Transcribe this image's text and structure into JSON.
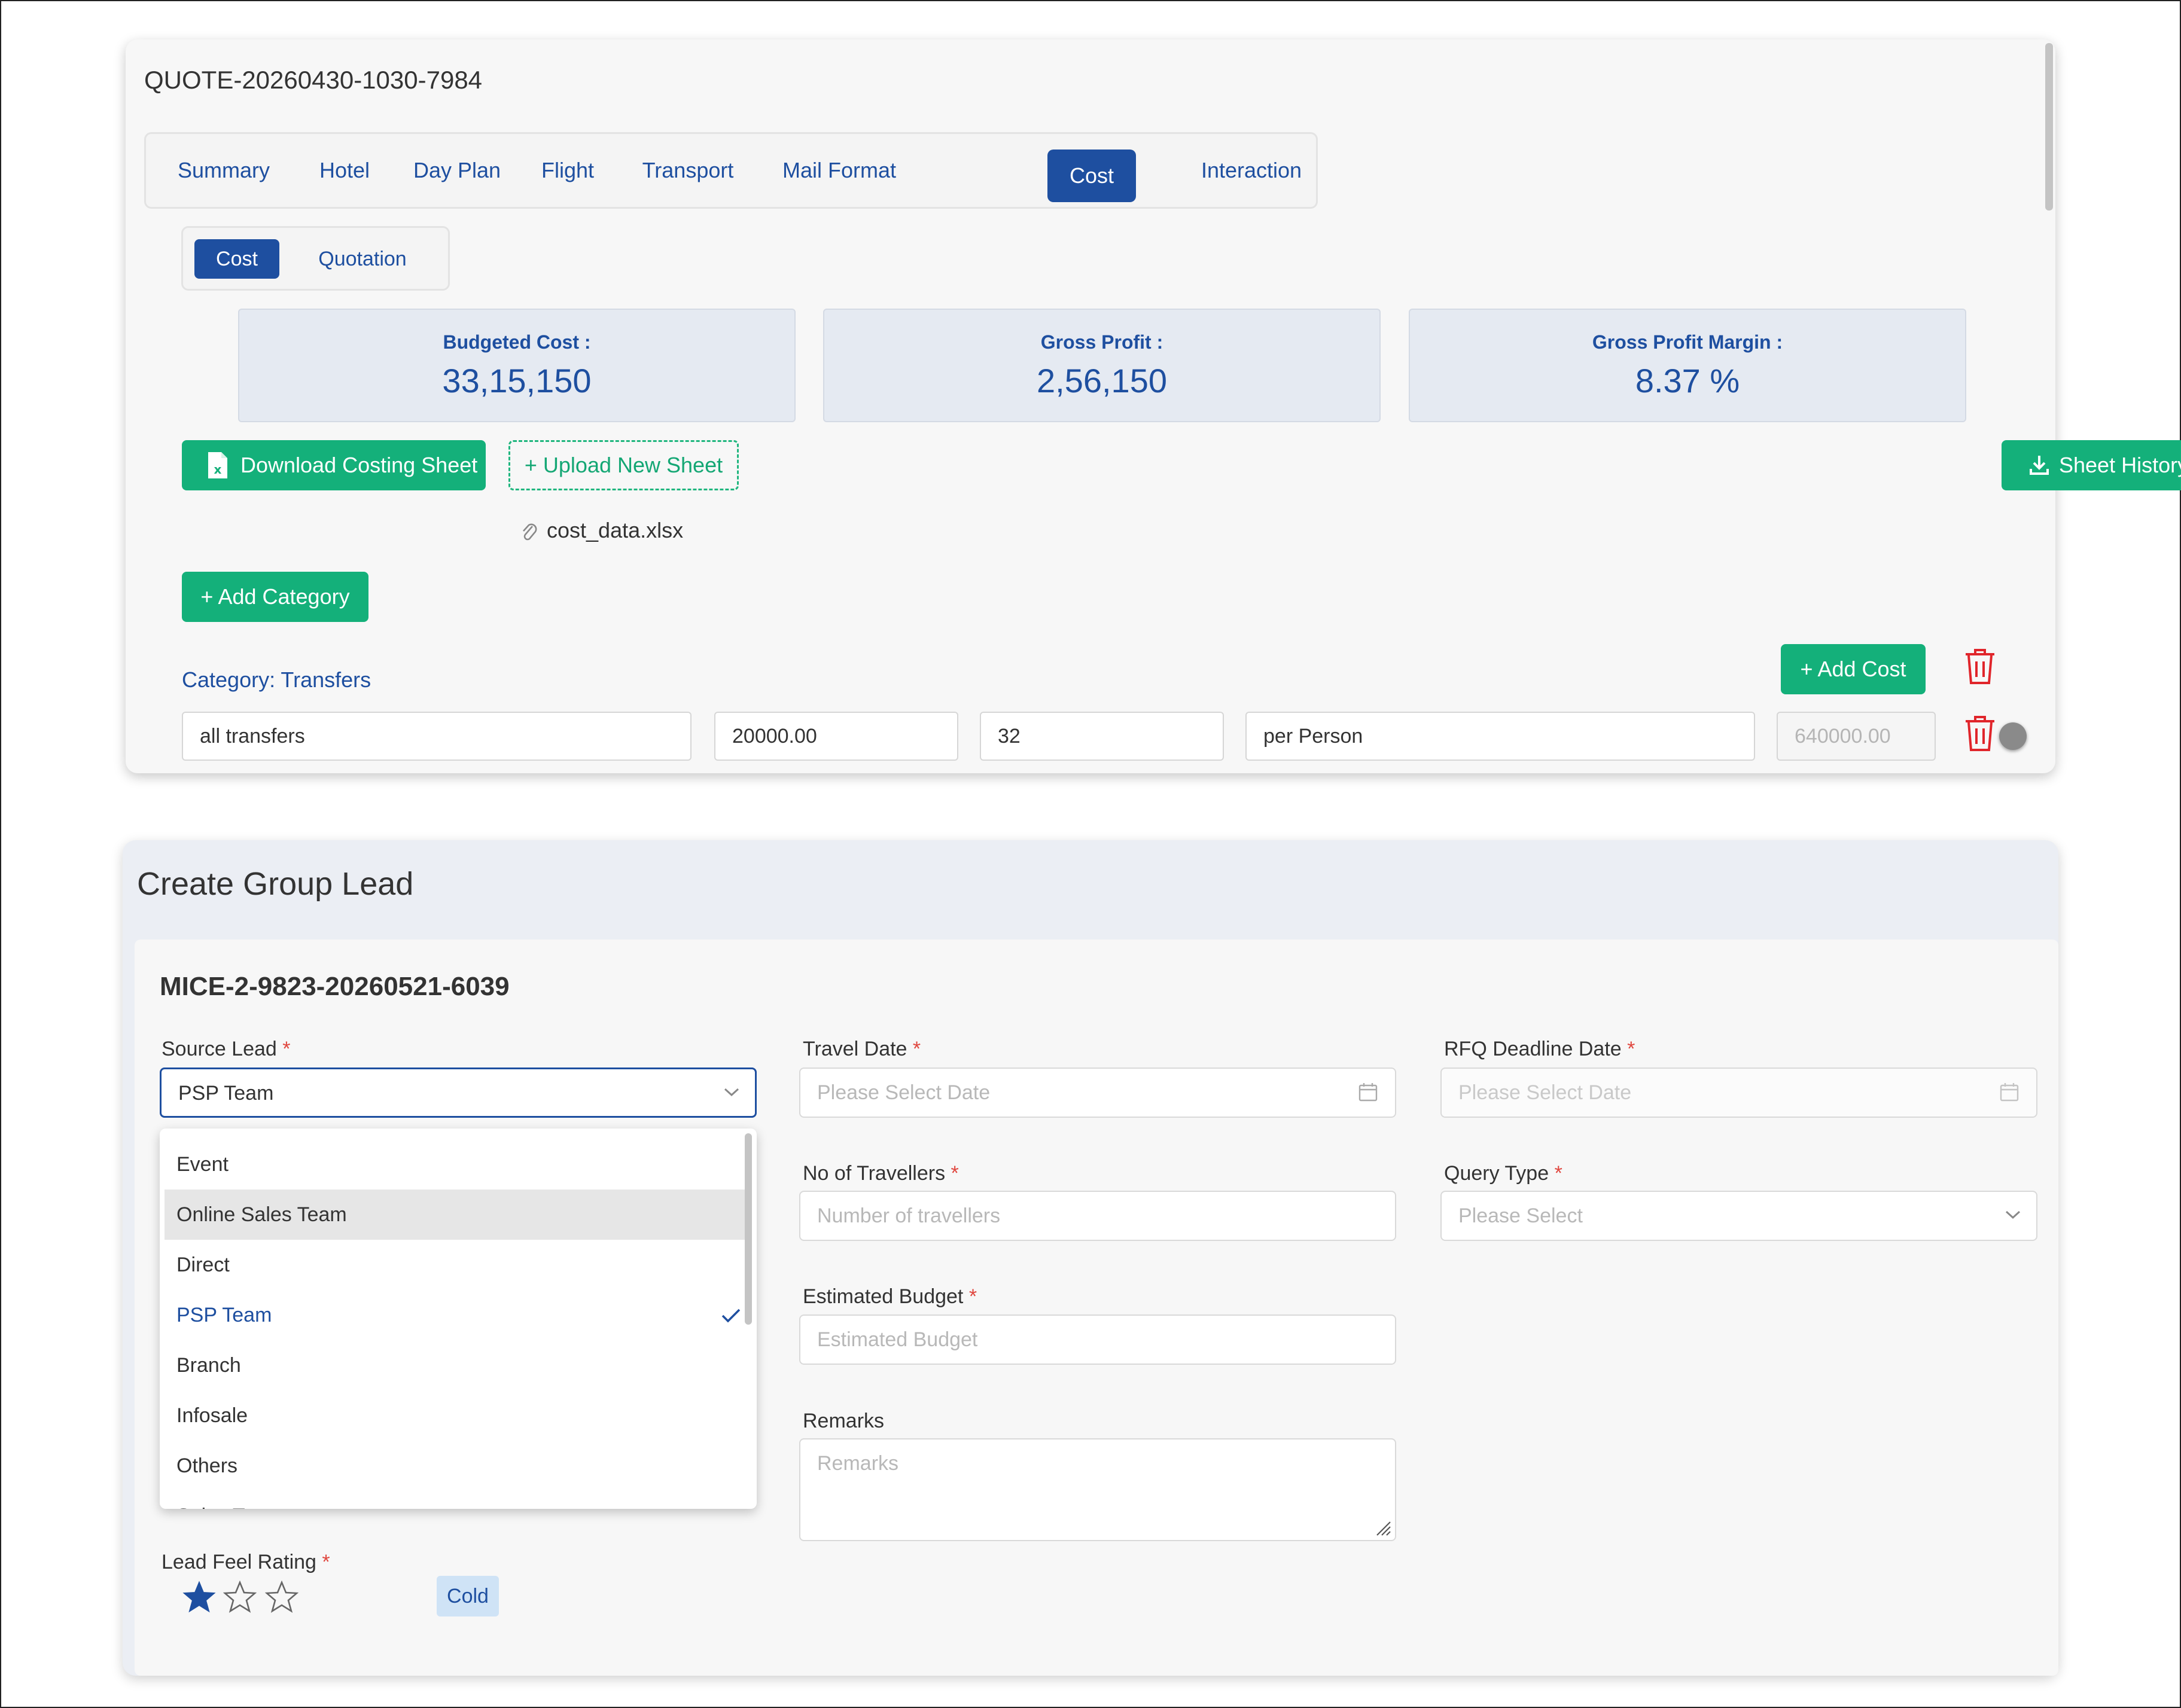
{
  "quote": {
    "id": "QUOTE-20260430-1030-7984",
    "tabs": [
      {
        "label": "Summary"
      },
      {
        "label": "Hotel"
      },
      {
        "label": "Day Plan"
      },
      {
        "label": "Flight"
      },
      {
        "label": "Transport"
      },
      {
        "label": "Mail Format"
      },
      {
        "label": "Cost"
      },
      {
        "label": "Interaction"
      }
    ],
    "active_tab": "Cost",
    "subtabs": [
      {
        "label": "Cost"
      },
      {
        "label": "Quotation"
      }
    ],
    "stats": [
      {
        "label": "Budgeted Cost :",
        "value": "33,15,150"
      },
      {
        "label": "Gross Profit :",
        "value": "2,56,150"
      },
      {
        "label": "Gross Profit Margin :",
        "value": "8.37 %"
      }
    ],
    "download_label": "Download Costing Sheet",
    "upload_label": "+ Upload New Sheet",
    "sheet_history_label": "Sheet History",
    "file_name": "cost_data.xlsx",
    "add_category_label": "+ Add Category",
    "category_label": "Category: Transfers",
    "add_cost_label": "+ Add Cost",
    "cost_row": {
      "description": "all transfers",
      "rate": "20000.00",
      "quantity": "32",
      "unit": "per Person",
      "total": "640000.00"
    },
    "colors": {
      "primary": "#1e4fa0",
      "success": "#14b07a",
      "danger": "#e0252b"
    }
  },
  "lead": {
    "title": "Create Group Lead",
    "id": "MICE-2-9823-20260521-6039",
    "source_lead": {
      "label": "Source Lead",
      "value": "PSP Team",
      "options": [
        "Event",
        "Online Sales Team",
        "Direct",
        "PSP Team",
        "Branch",
        "Infosale",
        "Others",
        "Sales T"
      ]
    },
    "travel_date": {
      "label": "Travel Date",
      "placeholder": "Please Select Date"
    },
    "rfq_deadline": {
      "label": "RFQ Deadline Date",
      "placeholder": "Please Select Date"
    },
    "travellers": {
      "label": "No of Travellers",
      "placeholder": "Number of travellers"
    },
    "query_type": {
      "label": "Query Type",
      "placeholder": "Please Select"
    },
    "budget": {
      "label": "Estimated Budget",
      "placeholder": "Estimated Budget"
    },
    "remarks": {
      "label": "Remarks",
      "placeholder": "Remarks"
    },
    "rating": {
      "label": "Lead Feel Rating",
      "value": 1,
      "max": 3,
      "badge": "Cold"
    },
    "required_mark": "*"
  }
}
